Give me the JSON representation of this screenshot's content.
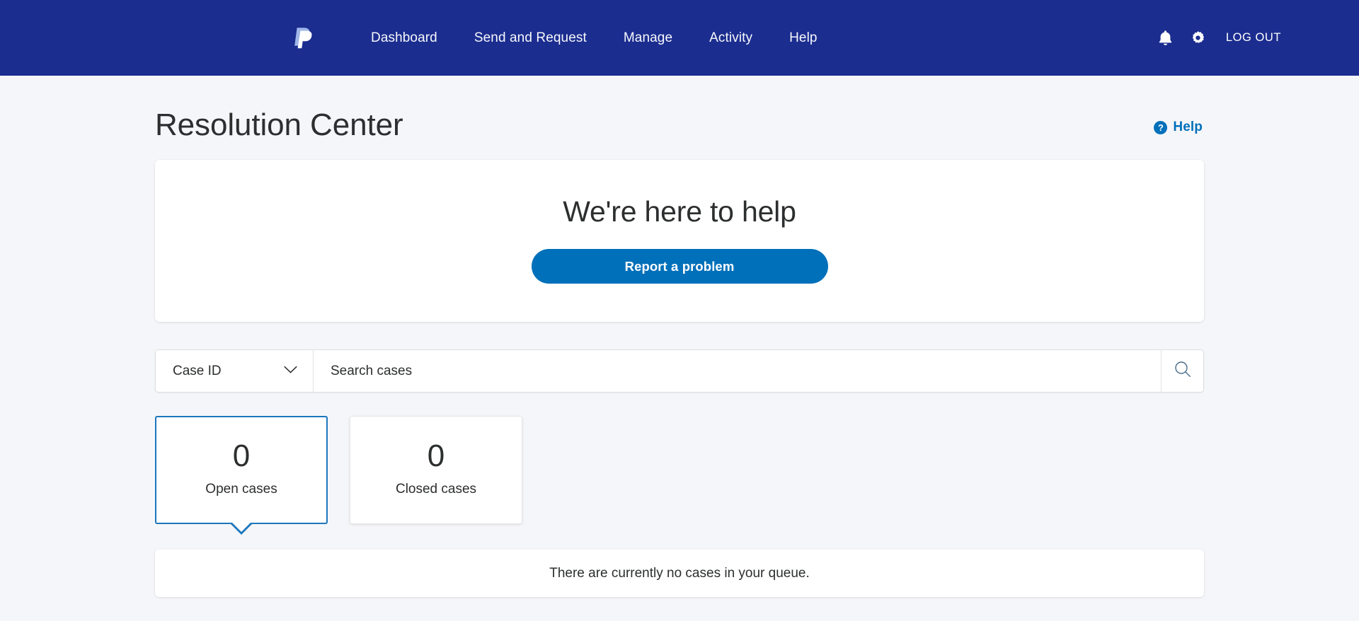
{
  "header": {
    "brand_icon": "paypal-logo",
    "nav_items": [
      {
        "label": "Dashboard"
      },
      {
        "label": "Send and Request"
      },
      {
        "label": "Manage"
      },
      {
        "label": "Activity"
      },
      {
        "label": "Help"
      }
    ],
    "notifications_icon": "bell-icon",
    "settings_icon": "gear-icon",
    "logout_label": "LOG OUT",
    "background_color": "#1b2d8f"
  },
  "page": {
    "title": "Resolution Center",
    "help": {
      "badge": "?",
      "label": "Help",
      "color": "#0070ba"
    }
  },
  "hero": {
    "title": "We're here to help",
    "button_label": "Report a problem",
    "button_color": "#0070ba"
  },
  "search": {
    "filter_selected": "Case ID",
    "filter_chevron_icon": "chevron-down-icon",
    "placeholder": "Search cases",
    "value": "",
    "search_icon": "search-icon"
  },
  "stats": [
    {
      "value": "0",
      "label": "Open cases",
      "selected": true
    },
    {
      "value": "0",
      "label": "Closed cases",
      "selected": false
    }
  ],
  "empty_state": {
    "message": "There are currently no cases in your queue."
  },
  "theme": {
    "page_background": "#f5f6fa",
    "accent": "#0070ba",
    "selected_border": "#1c76bc",
    "text": "#2c2e2f"
  }
}
